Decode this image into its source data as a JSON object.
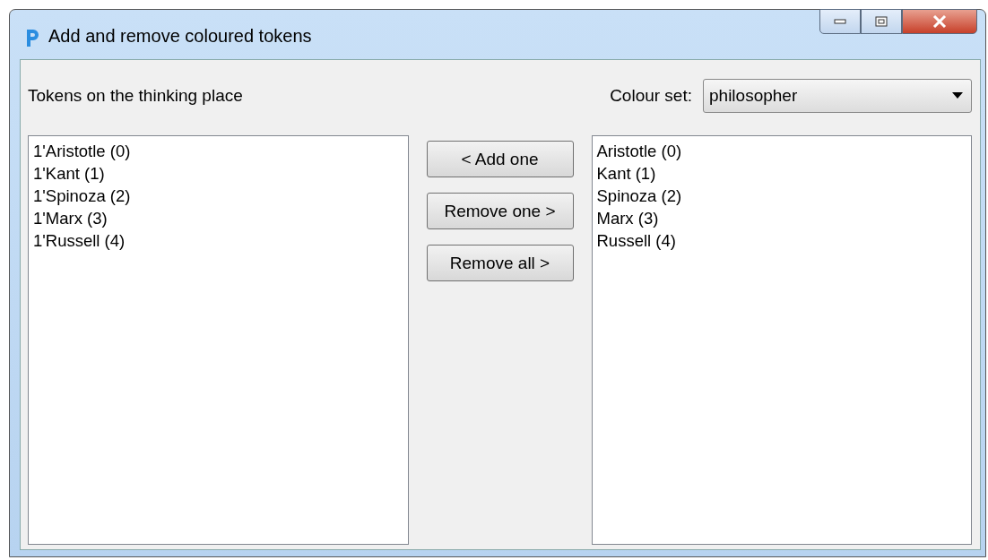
{
  "window": {
    "title": "Add and remove coloured tokens"
  },
  "tokens_label": "Tokens on the thinking place",
  "colour_set": {
    "label": "Colour set:",
    "value": "philosopher"
  },
  "tokens": [
    "1'Aristotle (0)",
    "1'Kant (1)",
    "1'Spinoza (2)",
    "1'Marx (3)",
    "1'Russell (4)"
  ],
  "buttons": [
    "< Add one",
    "Remove one >",
    "Remove all >"
  ],
  "colours": [
    "Aristotle (0)",
    "Kant (1)",
    "Spinoza (2)",
    "Marx (3)",
    "Russell (4)"
  ]
}
